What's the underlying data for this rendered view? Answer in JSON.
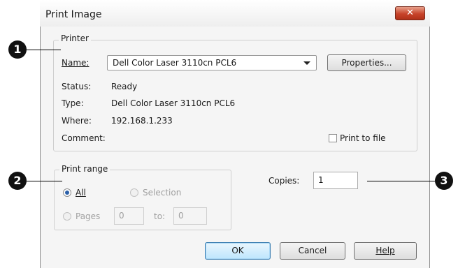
{
  "window": {
    "title": "Print Image",
    "close_glyph": "✕"
  },
  "printer": {
    "group_label": "Printer",
    "name_label": "Name:",
    "name_value": "Dell Color Laser 3110cn PCL6",
    "properties_button": "Properties...",
    "status_label": "Status:",
    "status_value": "Ready",
    "type_label": "Type:",
    "type_value": "Dell Color Laser 3110cn PCL6",
    "where_label": "Where:",
    "where_value": "192.168.1.233",
    "comment_label": "Comment:",
    "comment_value": "",
    "print_to_file_label": "Print to file",
    "print_to_file_checked": false
  },
  "print_range": {
    "group_label": "Print range",
    "all_label": "All",
    "all_selected": true,
    "selection_label": "Selection",
    "pages_label": "Pages",
    "from_value": "0",
    "to_label": "to:",
    "to_value": "0"
  },
  "copies": {
    "label": "Copies:",
    "value": "1"
  },
  "buttons": {
    "ok": "OK",
    "cancel": "Cancel",
    "help": "Help"
  },
  "callouts": [
    "1",
    "2",
    "3"
  ]
}
